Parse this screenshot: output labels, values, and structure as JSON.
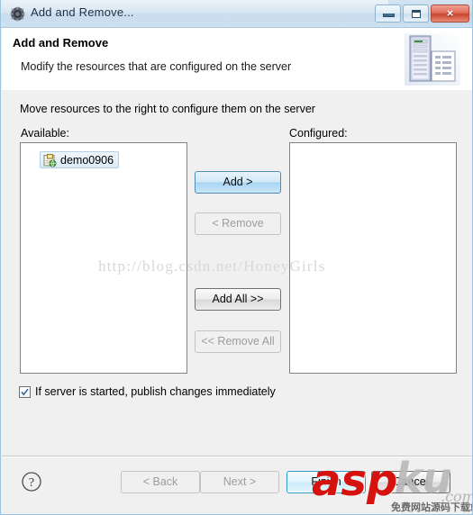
{
  "window": {
    "title": "Add and Remove...",
    "icon": "gear-icon",
    "minimize_label": "Minimize",
    "maximize_label": "Maximize",
    "close_label": "×"
  },
  "banner": {
    "title": "Add and Remove",
    "description": "Modify the resources that are configured on the server",
    "icon": "server-and-document-icon"
  },
  "content": {
    "instruction": "Move resources to the right to configure them on the server",
    "available_label": "Available:",
    "configured_label": "Configured:",
    "available_items": [
      {
        "label": "demo0906",
        "icon": "web-project-icon",
        "selected": true
      }
    ],
    "configured_items": [],
    "transfer_buttons": [
      {
        "label": "Add >",
        "state": "primary"
      },
      {
        "label": "< Remove",
        "state": "disabled"
      },
      {
        "label": "Add All >>",
        "state": "normal"
      },
      {
        "label": "<< Remove All",
        "state": "disabled"
      }
    ],
    "publish_checkbox": {
      "label": "If server is started, publish changes immediately",
      "checked": true
    }
  },
  "footer": {
    "help_icon": "question-mark-icon",
    "buttons": [
      {
        "label": "< Back",
        "state": "disabled"
      },
      {
        "label": "Next >",
        "state": "disabled"
      },
      {
        "label": "Finish",
        "state": "default"
      },
      {
        "label": "Cancel",
        "state": "normal"
      }
    ]
  },
  "watermarks": {
    "url": "http://blog.csdn.net/HoneyGirls",
    "logo_asp": "asp",
    "logo_ku": "ku",
    "logo_com": ".com",
    "logo_cn": "免费网站源码下载站"
  },
  "colors": {
    "titlebar": "#c6dcee",
    "accent": "#4f8cb5",
    "close_red": "#c9452f",
    "watermark_red": "#d6120e"
  }
}
